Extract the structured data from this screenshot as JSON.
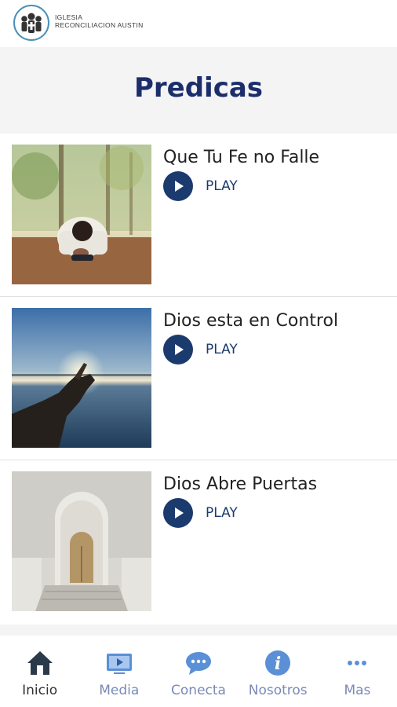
{
  "header": {
    "brand_line1": "IGLESIA",
    "brand_line2": "RECONCILIACION AUSTIN"
  },
  "page": {
    "title": "Predicas"
  },
  "sermons": [
    {
      "title": "Que Tu Fe no Falle",
      "play_label": "PLAY",
      "image": "person-praying-image"
    },
    {
      "title": "Dios esta en Control",
      "play_label": "PLAY",
      "image": "hand-sunset-image"
    },
    {
      "title": "Dios Abre Puertas",
      "play_label": "PLAY",
      "image": "door-arch-image"
    }
  ],
  "tabs": [
    {
      "label": "Inicio",
      "icon": "home-icon",
      "active": true
    },
    {
      "label": "Media",
      "icon": "media-icon",
      "active": false
    },
    {
      "label": "Conecta",
      "icon": "chat-icon",
      "active": false
    },
    {
      "label": "Nosotros",
      "icon": "info-icon",
      "active": false
    },
    {
      "label": "Mas",
      "icon": "more-icon",
      "active": false
    }
  ],
  "colors": {
    "accent": "#1b3a6e",
    "title": "#1b2d6b",
    "tab_inactive": "#7a8ab5",
    "tab_icon": "#5b8fd6"
  }
}
